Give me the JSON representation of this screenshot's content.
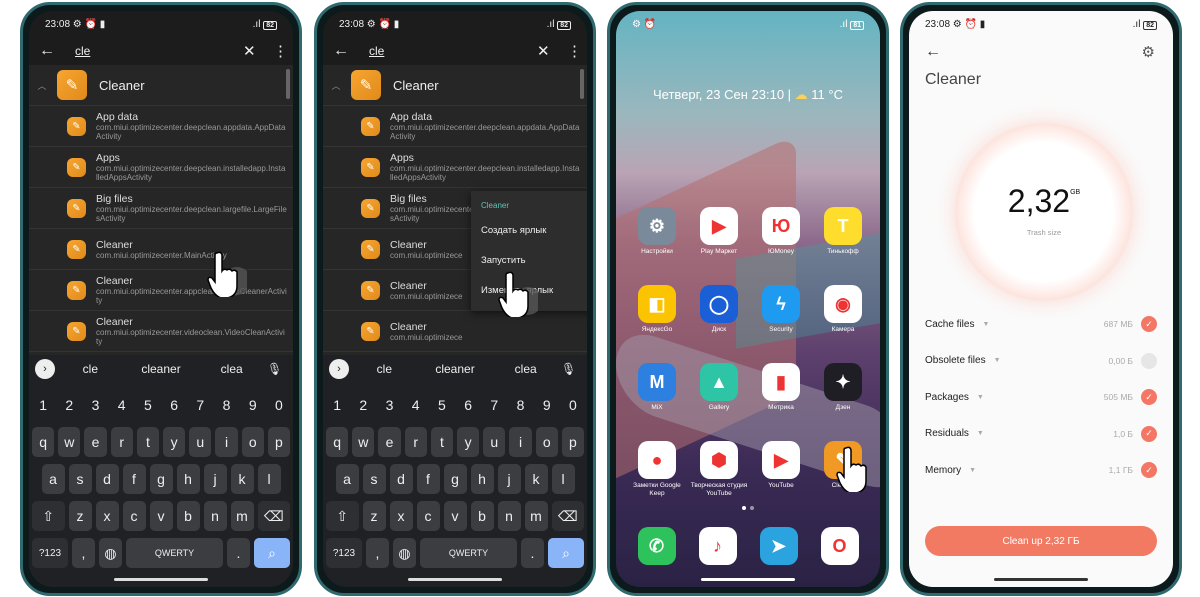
{
  "status": {
    "time": "23:08",
    "battery": "82",
    "battery_home": "81"
  },
  "search": {
    "query": "cle",
    "back_icon": "arrow-left-icon",
    "clear_icon": "close-icon",
    "more_icon": "more-vert-icon"
  },
  "group": {
    "name": "Cleaner"
  },
  "activities": [
    {
      "title": "App data",
      "class": "com.miui.optimizecenter.deepclean.appdata.AppDataActivity"
    },
    {
      "title": "Apps",
      "class": "com.miui.optimizecenter.deepclean.installedapp.InstalledAppsActivity"
    },
    {
      "title": "Big files",
      "class": "com.miui.optimizecenter.deepclean.largefile.LargeFilesActivity"
    },
    {
      "title": "Cleaner",
      "class": "com.miui.optimizecenter.MainActivity"
    },
    {
      "title": "Cleaner",
      "class": "com.miui.optimizecenter.appcleaner.AppCleanerActivity"
    },
    {
      "title": "Cleaner",
      "class": "com.miui.optimizecenter.videoclean.VideoCleanActivity"
    }
  ],
  "activities_truncated": [
    {
      "title": "App data",
      "class": "com.miui.optimizecenter.deepclean.appdata.AppDataActivity"
    },
    {
      "title": "Apps",
      "class": "com.miui.optimizecenter.deepclean.installedapp.InstalledAppsActivity"
    },
    {
      "title": "Big files",
      "class": "com.miui.optimizecenter.deepclean.largefile.LargeFilesActivity"
    },
    {
      "title": "Cleaner",
      "class": "com.miui.optimizece"
    },
    {
      "title": "Cleaner",
      "class": "com.miui.optimizece"
    },
    {
      "title": "Cleaner",
      "class": "com.miui.optimizece"
    }
  ],
  "context_menu": {
    "header": "Cleaner",
    "items": [
      "Создать ярлык",
      "Запустить",
      "Изменить ярлык"
    ]
  },
  "keyboard": {
    "suggestions": [
      "cle",
      "cleaner",
      "clea"
    ],
    "numbers": [
      "1",
      "2",
      "3",
      "4",
      "5",
      "6",
      "7",
      "8",
      "9",
      "0"
    ],
    "row1": [
      "q",
      "w",
      "e",
      "r",
      "t",
      "y",
      "u",
      "i",
      "o",
      "p"
    ],
    "row2": [
      "a",
      "s",
      "d",
      "f",
      "g",
      "h",
      "j",
      "k",
      "l"
    ],
    "row3": [
      "z",
      "x",
      "c",
      "v",
      "b",
      "n",
      "m"
    ],
    "symbols": "?123",
    "comma": ",",
    "space": "QWERTY",
    "period": ".",
    "shift_icon": "shift-icon",
    "backspace_icon": "backspace-icon",
    "search_icon": "search-icon",
    "mic_icon": "mic-icon",
    "globe_icon": "globe-icon"
  },
  "home": {
    "date": "Четверг, 23 Сен  23:10",
    "weather": "11 °C",
    "apps": [
      {
        "label": "Настройки",
        "icon": "settings-icon",
        "color": "#7a8a9a",
        "glyph": "⚙"
      },
      {
        "label": "Play Маркет",
        "icon": "play-store-icon",
        "color": "#ffffff",
        "glyph": "▶"
      },
      {
        "label": "ЮMoney",
        "icon": "yumoney-icon",
        "color": "#ffffff",
        "glyph": "Ю"
      },
      {
        "label": "Тинькофф",
        "icon": "tinkoff-icon",
        "color": "#ffdd2d",
        "glyph": "Т"
      },
      {
        "label": "ЯндексGo",
        "icon": "yandex-go-icon",
        "color": "#fcc400",
        "glyph": "◧"
      },
      {
        "label": "Диск",
        "icon": "disk-icon",
        "color": "#1a5fd6",
        "glyph": "◯"
      },
      {
        "label": "Security",
        "icon": "security-icon",
        "color": "#1e9bf0",
        "glyph": "ϟ"
      },
      {
        "label": "Камера",
        "icon": "camera-icon",
        "color": "#ffffff",
        "glyph": "◉"
      },
      {
        "label": "MiX",
        "icon": "mix-icon",
        "color": "#2d7fe0",
        "glyph": "M"
      },
      {
        "label": "Gallery",
        "icon": "gallery-icon",
        "color": "#2ec4a6",
        "glyph": "▲"
      },
      {
        "label": "Метрика",
        "icon": "metrika-icon",
        "color": "#ffffff",
        "glyph": "▮"
      },
      {
        "label": "Дзен",
        "icon": "zen-icon",
        "color": "#1e1e24",
        "glyph": "✦"
      },
      {
        "label": "Заметки Google Keep",
        "icon": "keep-icon",
        "color": "#ffffff",
        "glyph": "●"
      },
      {
        "label": "Творческая студия YouTube",
        "icon": "yt-studio-icon",
        "color": "#ffffff",
        "glyph": "⬢"
      },
      {
        "label": "YouTube",
        "icon": "youtube-icon",
        "color": "#ffffff",
        "glyph": "▶"
      },
      {
        "label": "Cleaner",
        "icon": "cleaner-icon",
        "color": "#f09a25",
        "glyph": "✎"
      }
    ],
    "dock": [
      {
        "icon": "phone-icon",
        "color": "#2ec25c",
        "glyph": "✆"
      },
      {
        "icon": "music-icon",
        "color": "#ffffff",
        "glyph": "♪"
      },
      {
        "icon": "telegram-icon",
        "color": "#2aa3de",
        "glyph": "➤"
      },
      {
        "icon": "opera-icon",
        "color": "#ffffff",
        "glyph": "O"
      }
    ]
  },
  "cleaner": {
    "title": "Cleaner",
    "size": "2,32",
    "unit": "GB",
    "size_label": "Trash size",
    "items": [
      {
        "label": "Cache files",
        "size": "687 МБ",
        "checked": true
      },
      {
        "label": "Obsolete files",
        "size": "0,00 Б",
        "checked": false
      },
      {
        "label": "Packages",
        "size": "505 МБ",
        "checked": true
      },
      {
        "label": "Residuals",
        "size": "1,0 Б",
        "checked": true
      },
      {
        "label": "Memory",
        "size": "1,1 ГБ",
        "checked": true
      }
    ],
    "button": "Clean up 2,32 ГБ",
    "accent": "#f27a63"
  }
}
